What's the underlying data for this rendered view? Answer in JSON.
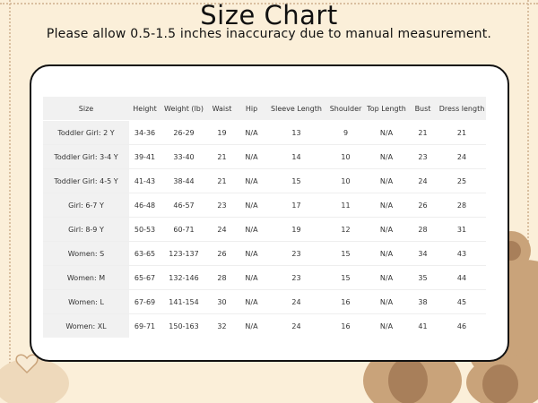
{
  "header": {
    "title": "Size Chart",
    "subtitle": "Please allow 0.5-1.5 inches inaccuracy due to manual measurement."
  },
  "table": {
    "columns": [
      "Size",
      "Height",
      "Weight (lb)",
      "Waist",
      "Hip",
      "Sleeve Length",
      "Shoulder",
      "Top Length",
      "Bust",
      "Dress length"
    ],
    "rows": [
      [
        "Toddler Girl: 2 Y",
        "34-36",
        "26-29",
        "19",
        "N/A",
        "13",
        "9",
        "N/A",
        "21",
        "21"
      ],
      [
        "Toddler Girl: 3-4 Y",
        "39-41",
        "33-40",
        "21",
        "N/A",
        "14",
        "10",
        "N/A",
        "23",
        "24"
      ],
      [
        "Toddler Girl: 4-5 Y",
        "41-43",
        "38-44",
        "21",
        "N/A",
        "15",
        "10",
        "N/A",
        "24",
        "25"
      ],
      [
        "Girl: 6-7 Y",
        "46-48",
        "46-57",
        "23",
        "N/A",
        "17",
        "11",
        "N/A",
        "26",
        "28"
      ],
      [
        "Girl: 8-9 Y",
        "50-53",
        "60-71",
        "24",
        "N/A",
        "19",
        "12",
        "N/A",
        "28",
        "31"
      ],
      [
        "Women: S",
        "63-65",
        "123-137",
        "26",
        "N/A",
        "23",
        "15",
        "N/A",
        "34",
        "43"
      ],
      [
        "Women: M",
        "65-67",
        "132-146",
        "28",
        "N/A",
        "23",
        "15",
        "N/A",
        "35",
        "44"
      ],
      [
        "Women: L",
        "67-69",
        "141-154",
        "30",
        "N/A",
        "24",
        "16",
        "N/A",
        "38",
        "45"
      ],
      [
        "Women: XL",
        "69-71",
        "150-163",
        "32",
        "N/A",
        "24",
        "16",
        "N/A",
        "41",
        "46"
      ]
    ]
  },
  "decor": {
    "background_color": "#fbefd9",
    "bear_color": "#c9a37a",
    "bear_dark": "#9c7552",
    "icons": [
      "teddy-bear-icon",
      "heart-icon"
    ]
  }
}
